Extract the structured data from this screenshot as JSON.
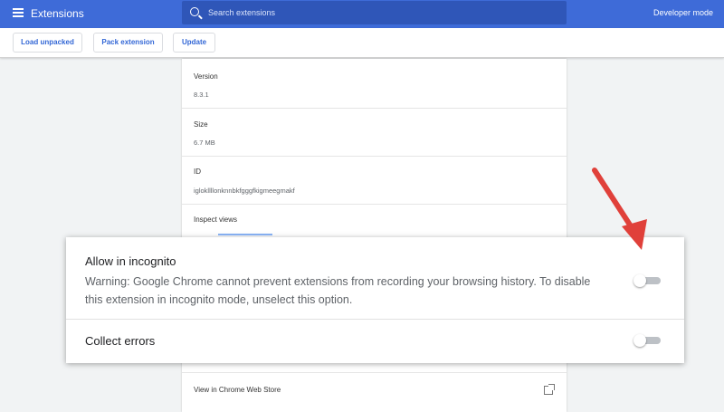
{
  "header": {
    "title": "Extensions",
    "search_placeholder": "Search extensions",
    "developer_mode_label": "Developer mode"
  },
  "toolbar": {
    "load_unpacked": "Load unpacked",
    "pack_extension": "Pack extension",
    "update": "Update"
  },
  "details": {
    "version_label": "Version",
    "version_value": "8.3.1",
    "size_label": "Size",
    "size_value": "6.7 MB",
    "id_label": "ID",
    "id_value": "iglokllllonknnbkfgggfkigmeegmakf",
    "inspect_label": "Inspect views",
    "webstore_label": "View in Chrome Web Store"
  },
  "popup": {
    "incognito_title": "Allow in incognito",
    "incognito_warning": "Warning: Google Chrome cannot prevent extensions from recording your browsing history. To disable this extension in incognito mode, unselect this option.",
    "collect_errors": "Collect errors",
    "incognito_enabled": false,
    "collect_errors_enabled": false
  },
  "colors": {
    "header_bg": "#3e6bd8",
    "accent": "#3367d6",
    "arrow": "#e0403a"
  }
}
